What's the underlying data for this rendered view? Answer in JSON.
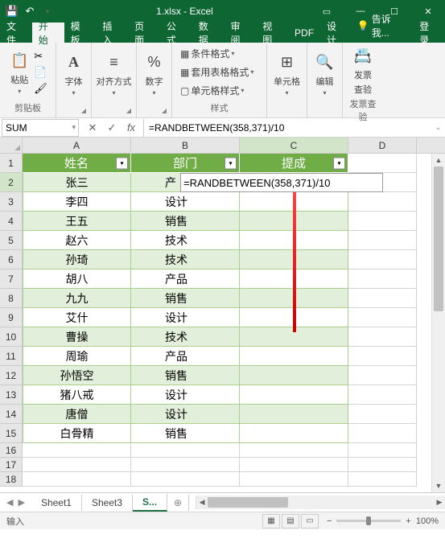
{
  "title": "1.xlsx - Excel",
  "tabs": {
    "file": "文件",
    "home": "开始",
    "template": "模板",
    "insert": "插入",
    "page": "页面",
    "formula": "公式",
    "data": "数据",
    "review": "审阅",
    "view": "视图",
    "pdf": "PDF",
    "design": "设计",
    "tellme": "告诉我...",
    "login": "登录"
  },
  "ribbon": {
    "clipboard": {
      "paste": "粘贴",
      "label": "剪贴板"
    },
    "font": {
      "label": "字体"
    },
    "align": {
      "label": "对齐方式"
    },
    "number": {
      "label": "数字"
    },
    "styles": {
      "cond": "条件格式",
      "table": "套用表格格式",
      "cell": "单元格样式",
      "label": "样式"
    },
    "cells": {
      "label": "单元格"
    },
    "editing": {
      "label": "编辑"
    },
    "invoice": {
      "line1": "发票",
      "line2": "查验",
      "label": "发票查验"
    }
  },
  "name_box": "SUM",
  "formula": "=RANDBETWEEN(358,371)/10",
  "columns": [
    "A",
    "B",
    "C",
    "D"
  ],
  "headers": {
    "a": "姓名",
    "b": "部门",
    "c": "提成"
  },
  "editing_overlay": "=RANDBETWEEN(358,371)/10",
  "rows": [
    {
      "a": "张三",
      "b": "产"
    },
    {
      "a": "李四",
      "b": "设计"
    },
    {
      "a": "王五",
      "b": "销售"
    },
    {
      "a": "赵六",
      "b": "技术"
    },
    {
      "a": "孙琦",
      "b": "技术"
    },
    {
      "a": "胡八",
      "b": "产品"
    },
    {
      "a": "九九",
      "b": "销售"
    },
    {
      "a": "艾什",
      "b": "设计"
    },
    {
      "a": "曹操",
      "b": "技术"
    },
    {
      "a": "周瑜",
      "b": "产品"
    },
    {
      "a": "孙悟空",
      "b": "销售"
    },
    {
      "a": "猪八戒",
      "b": "设计"
    },
    {
      "a": "唐僧",
      "b": "设计"
    },
    {
      "a": "白骨精",
      "b": "销售"
    }
  ],
  "sheets": {
    "s1": "Sheet1",
    "s3": "Sheet3",
    "active": "S..."
  },
  "status": {
    "mode": "输入",
    "zoom": "100%"
  }
}
